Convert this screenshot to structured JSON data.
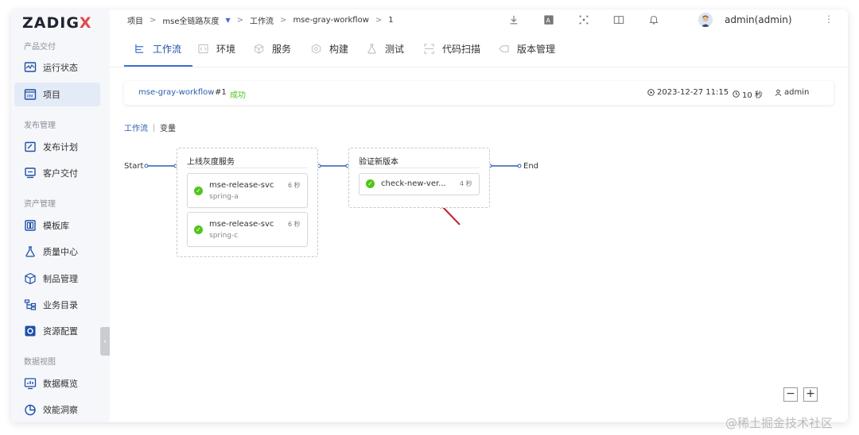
{
  "sidebar": {
    "logo": "ZADIG",
    "logo_x": "X",
    "sections": [
      {
        "title": "产品交付"
      },
      {
        "title": "发布管理"
      },
      {
        "title": "资产管理"
      },
      {
        "title": "数据视图"
      }
    ],
    "items": [
      {
        "label": "运行状态",
        "icon": "monitor-icon"
      },
      {
        "label": "项目",
        "icon": "project-icon",
        "active": true
      },
      {
        "label": "发布计划",
        "icon": "calendar-edit-icon"
      },
      {
        "label": "客户交付",
        "icon": "delivery-icon"
      },
      {
        "label": "模板库",
        "icon": "template-icon"
      },
      {
        "label": "质量中心",
        "icon": "flask-icon"
      },
      {
        "label": "制品管理",
        "icon": "package-icon"
      },
      {
        "label": "业务目录",
        "icon": "tree-icon"
      },
      {
        "label": "资源配置",
        "icon": "settings-icon"
      },
      {
        "label": "数据概览",
        "icon": "chart-icon"
      },
      {
        "label": "效能洞察",
        "icon": "pie-icon"
      }
    ]
  },
  "breadcrumb": {
    "items": [
      "项目",
      "mse全链路灰度",
      "工作流",
      "mse-gray-workflow",
      "1"
    ],
    "separator": ">"
  },
  "header": {
    "user": "admin(admin)"
  },
  "tabs": [
    {
      "label": "工作流",
      "active": true
    },
    {
      "label": "环境"
    },
    {
      "label": "服务"
    },
    {
      "label": "构建"
    },
    {
      "label": "测试"
    },
    {
      "label": "代码扫描"
    },
    {
      "label": "版本管理"
    }
  ],
  "run": {
    "workflow": "mse-gray-workflow",
    "number": "#1",
    "status": "成功",
    "datetime": "2023-12-27 11:15",
    "duration": "10 秒",
    "user": "admin"
  },
  "subtabs": {
    "workflow": "工作流",
    "variables": "变量"
  },
  "pipeline": {
    "start": "Start",
    "end": "End",
    "stages": [
      {
        "title": "上线灰度服务",
        "jobs": [
          {
            "name": "mse-release-svc",
            "sub": "spring-a",
            "time": "6 秒"
          },
          {
            "name": "mse-release-svc",
            "sub": "spring-c",
            "time": "6 秒"
          }
        ]
      },
      {
        "title": "验证新版本",
        "jobs": [
          {
            "name": "check-new-ver...",
            "time": "4 秒"
          }
        ]
      }
    ]
  },
  "zoom": {
    "out": "−",
    "in": "+"
  },
  "watermark": "@稀土掘金技术社区",
  "colors": {
    "accent": "#3a6fd8",
    "success": "#52c41a",
    "arrow": "#c0262d"
  }
}
